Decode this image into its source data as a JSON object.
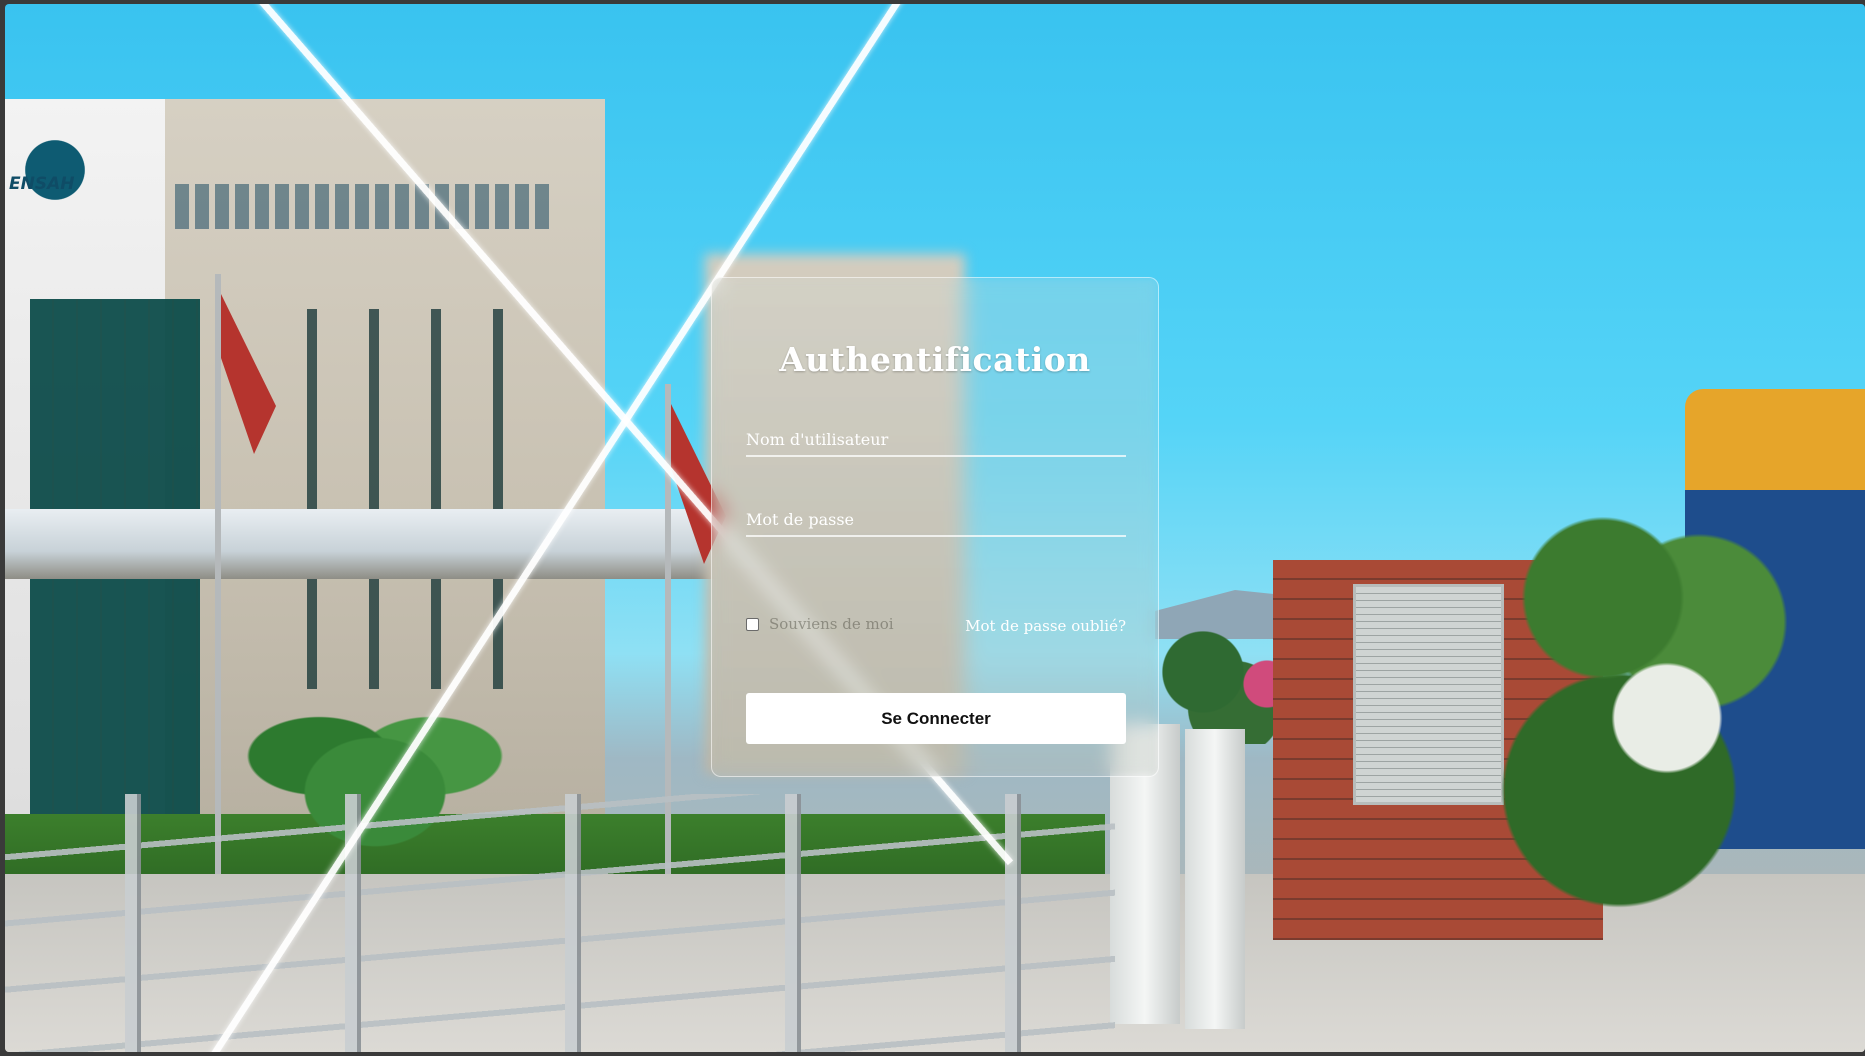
{
  "login": {
    "title": "Authentification",
    "username_placeholder": "Nom d'utilisateur",
    "password_placeholder": "Mot de passe",
    "remember_label": "Souviens de moi",
    "forgot_link": "Mot de passe oublié?",
    "submit_label": "Se Connecter"
  },
  "background": {
    "logo_text": "ENSAH"
  },
  "colors": {
    "sky": "#39c3f0",
    "button_bg": "#ffffff",
    "button_text": "#111111",
    "text": "#ffffff"
  },
  "icons": {
    "remember_checkbox": "checkbox-unchecked"
  }
}
